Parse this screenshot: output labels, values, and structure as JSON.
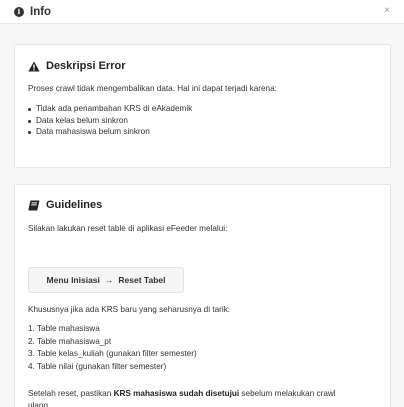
{
  "header": {
    "title": "Info",
    "info_icon": "i",
    "close_label": "×"
  },
  "error_card": {
    "title": "Deskripsi Error",
    "intro": "Proses crawl tidak mengembalikan data. Hal ini dapat terjadi karena:",
    "reasons": [
      "Tidak ada penambahan KRS di eAkademik",
      "Data kelas belum sinkron",
      "Data mahasiswa belum sinkron"
    ]
  },
  "guide_card": {
    "title": "Guidelines",
    "intro": "Silakan lakukan reset table di aplikasi eFeeder melalui:",
    "menu_path": {
      "from": "Menu Inisiasi",
      "arrow": "→",
      "to": "Reset Tabel"
    },
    "tables_intro": "Khususnya jika ada KRS baru yang seharusnya di tarik:",
    "tables": [
      "1. Table mahasiswa",
      "2. Table mahasiswa_pt",
      "3. Table kelas_kuliah (gunakan filter semester)",
      "4. Table nilai (gunakan filter semester)"
    ],
    "note_before": "Setelah reset, pastikan ",
    "note_bold": "KRS mahasiswa sudah disetujui",
    "note_after": " sebelum melakukan crawl",
    "note_line2": "ulang"
  }
}
